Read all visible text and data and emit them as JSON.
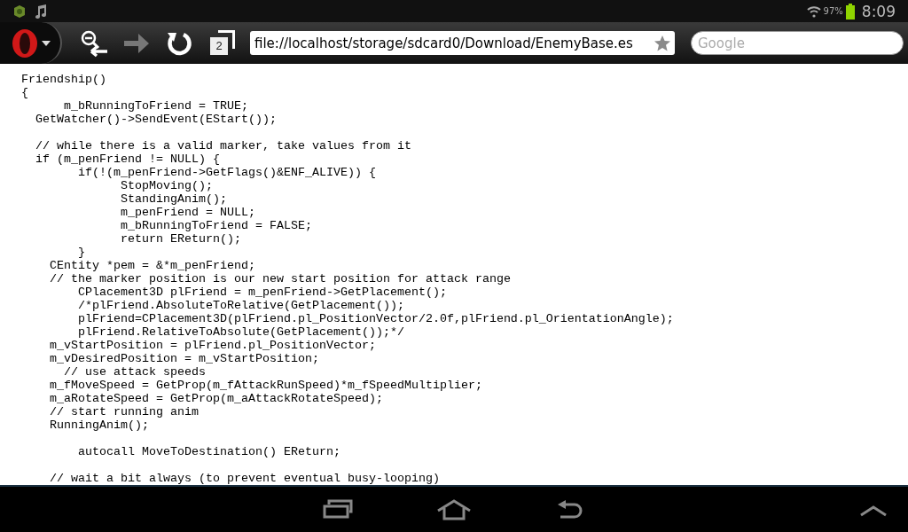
{
  "status_bar": {
    "battery": "97%",
    "time": "8:09"
  },
  "toolbar": {
    "buttons": [
      {
        "kind": "zoom-back",
        "disabled": false
      },
      {
        "kind": "forward",
        "disabled": true
      },
      {
        "kind": "reload",
        "disabled": false
      },
      {
        "kind": "tabs",
        "disabled": false,
        "count": "2"
      }
    ],
    "address": "file://localhost/storage/sdcard0/Download/EnemyBase.es",
    "search": {
      "placeholder": "Google"
    }
  },
  "page": {
    "code": "Friendship()\n{\n      m_bRunningToFriend = TRUE;\n  GetWatcher()->SendEvent(EStart());\n\n  // while there is a valid marker, take values from it\n  if (m_penFriend != NULL) {\n        if(!(m_penFriend->GetFlags()&ENF_ALIVE)) {\n              StopMoving();\n              StandingAnim();\n              m_penFriend = NULL;\n              m_bRunningToFriend = FALSE;\n              return EReturn();\n        }\n    CEntity *pem = &*m_penFriend;\n    // the marker position is our new start position for attack range\n        CPlacement3D plFriend = m_penFriend->GetPlacement();\n        /*plFriend.AbsoluteToRelative(GetPlacement());\n        plFriend=CPlacement3D(plFriend.pl_PositionVector/2.0f,plFriend.pl_OrientationAngle);\n        plFriend.RelativeToAbsolute(GetPlacement());*/\n    m_vStartPosition = plFriend.pl_PositionVector;\n    m_vDesiredPosition = m_vStartPosition;\n      // use attack speeds\n    m_fMoveSpeed = GetProp(m_fAttackRunSpeed)*m_fSpeedMultiplier;\n    m_aRotateSpeed = GetProp(m_aAttackRotateSpeed);\n    // start running anim\n    RunningAnim();\n\n        autocall MoveToDestination() EReturn;\n\n    // wait a bit always (to prevent eventual busy-looping)"
  }
}
